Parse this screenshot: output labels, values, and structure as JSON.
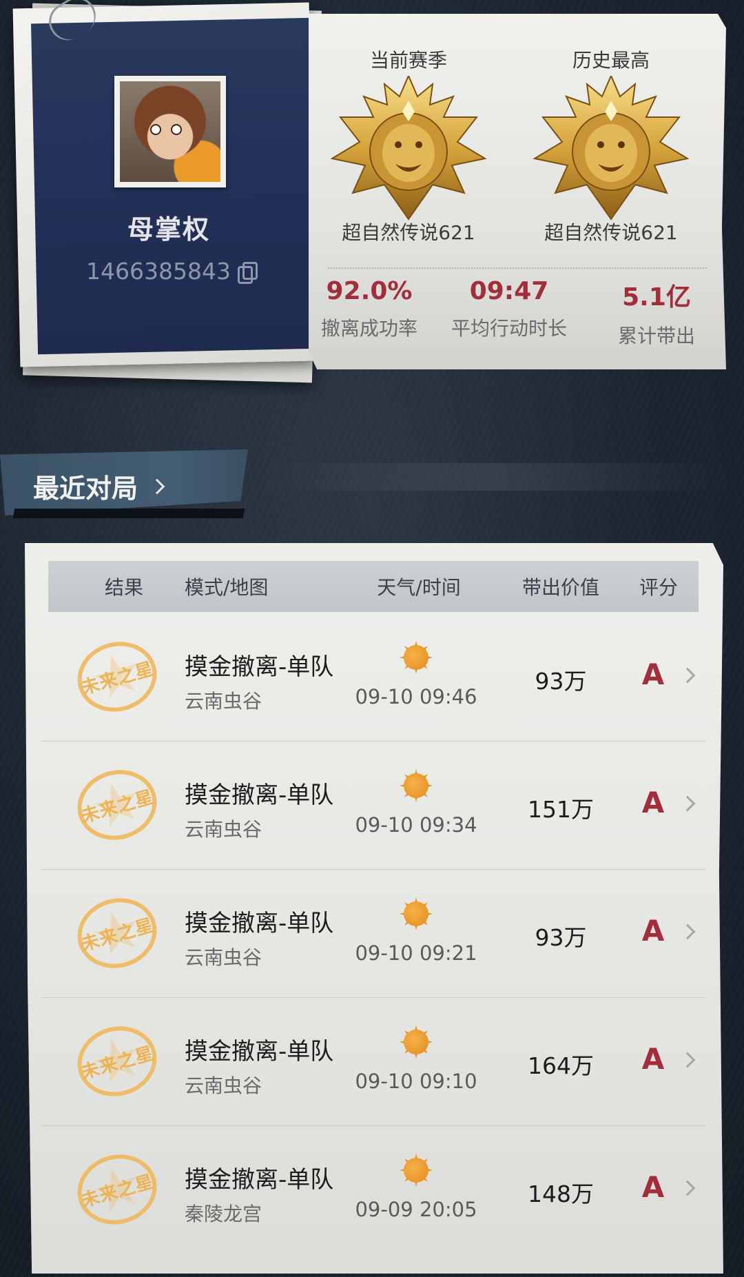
{
  "profile": {
    "name": "母掌权",
    "id": "1466385843"
  },
  "rank": {
    "current": {
      "label": "当前赛季",
      "tier": "超自然传说621"
    },
    "best": {
      "label": "历史最高",
      "tier": "超自然传说621"
    }
  },
  "stats": [
    {
      "value": "92.0%",
      "label": "撤离成功率"
    },
    {
      "value": "09:47",
      "label": "平均行动时长"
    },
    {
      "value": "5.1亿",
      "label": "累计带出"
    }
  ],
  "recent": {
    "title": "最近对局"
  },
  "table": {
    "headers": {
      "result": "结果",
      "mode": "模式/地图",
      "weather": "天气/时间",
      "value": "带出价值",
      "score": "评分"
    },
    "rows": [
      {
        "stamp": "未来之星",
        "mode": "摸金撤离-单队",
        "map": "云南虫谷",
        "weather_icon": "sun-icon",
        "time": "09-10 09:46",
        "value": "93万",
        "grade": "A"
      },
      {
        "stamp": "未来之星",
        "mode": "摸金撤离-单队",
        "map": "云南虫谷",
        "weather_icon": "sun-icon",
        "time": "09-10 09:34",
        "value": "151万",
        "grade": "A"
      },
      {
        "stamp": "未来之星",
        "mode": "摸金撤离-单队",
        "map": "云南虫谷",
        "weather_icon": "sun-icon",
        "time": "09-10 09:21",
        "value": "93万",
        "grade": "A"
      },
      {
        "stamp": "未来之星",
        "mode": "摸金撤离-单队",
        "map": "云南虫谷",
        "weather_icon": "sun-icon",
        "time": "09-10 09:10",
        "value": "164万",
        "grade": "A"
      },
      {
        "stamp": "未来之星",
        "mode": "摸金撤离-单队",
        "map": "秦陵龙宫",
        "weather_icon": "sun-icon",
        "time": "09-09 20:05",
        "value": "148万",
        "grade": "A"
      }
    ]
  },
  "colors": {
    "accent_red": "#a12e3a",
    "stamp_gold": "#eeae47",
    "sun_orange": "#e9951f",
    "profile_navy": "#24325a"
  }
}
